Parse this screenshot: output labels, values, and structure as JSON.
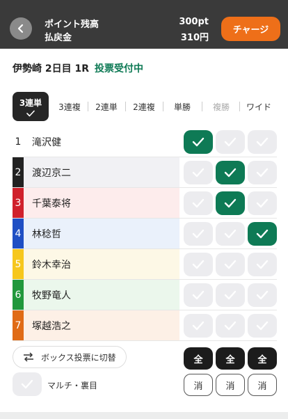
{
  "header": {
    "points_label": "ポイント残高",
    "refund_label": "払戻金",
    "points_value": "300pt",
    "refund_value": "310円",
    "charge_label": "チャージ"
  },
  "race": {
    "venue": "伊勢崎 2日目 1R",
    "status": "投票受付中"
  },
  "tabs": [
    {
      "label": "3連単",
      "active": true,
      "disabled": false
    },
    {
      "label": "3連複",
      "active": false,
      "disabled": false
    },
    {
      "label": "2連単",
      "active": false,
      "disabled": false
    },
    {
      "label": "2連複",
      "active": false,
      "disabled": false
    },
    {
      "label": "単勝",
      "active": false,
      "disabled": false
    },
    {
      "label": "複勝",
      "active": false,
      "disabled": true
    },
    {
      "label": "ワイド",
      "active": false,
      "disabled": false
    }
  ],
  "horses": [
    {
      "num": "1",
      "name": "滝沢健",
      "num_bg": "#ffffff",
      "num_fg": "#222222",
      "row_bg": "#ffffff",
      "checks": [
        true,
        false,
        false
      ]
    },
    {
      "num": "2",
      "name": "渡辺京二",
      "num_bg": "#222222",
      "num_fg": "#ffffff",
      "row_bg": "#f1f1f4",
      "checks": [
        false,
        true,
        false
      ]
    },
    {
      "num": "3",
      "name": "千葉泰将",
      "num_bg": "#d0202b",
      "num_fg": "#ffffff",
      "row_bg": "#fdecec",
      "checks": [
        false,
        true,
        false
      ]
    },
    {
      "num": "4",
      "name": "林稔哲",
      "num_bg": "#1f4fc4",
      "num_fg": "#ffffff",
      "row_bg": "#eaf1fb",
      "checks": [
        false,
        false,
        true
      ]
    },
    {
      "num": "5",
      "name": "鈴木幸治",
      "num_bg": "#f6c71d",
      "num_fg": "#ffffff",
      "row_bg": "#fdf8e6",
      "checks": [
        false,
        false,
        false
      ]
    },
    {
      "num": "6",
      "name": "牧野竜人",
      "num_bg": "#21983c",
      "num_fg": "#ffffff",
      "row_bg": "#ebf7ec",
      "checks": [
        false,
        false,
        false
      ]
    },
    {
      "num": "7",
      "name": "塚越浩之",
      "num_bg": "#e06b16",
      "num_fg": "#ffffff",
      "row_bg": "#fdf0e6",
      "checks": [
        false,
        false,
        false
      ]
    }
  ],
  "controls": {
    "box_label": "ボックス投票に切替",
    "multi_label": "マルチ・裏目",
    "all_label": "全",
    "clear_label": "消"
  },
  "colors": {
    "accent": "#ee6f19",
    "selected": "#0e7a55",
    "header_bg": "#3a3a3a"
  }
}
